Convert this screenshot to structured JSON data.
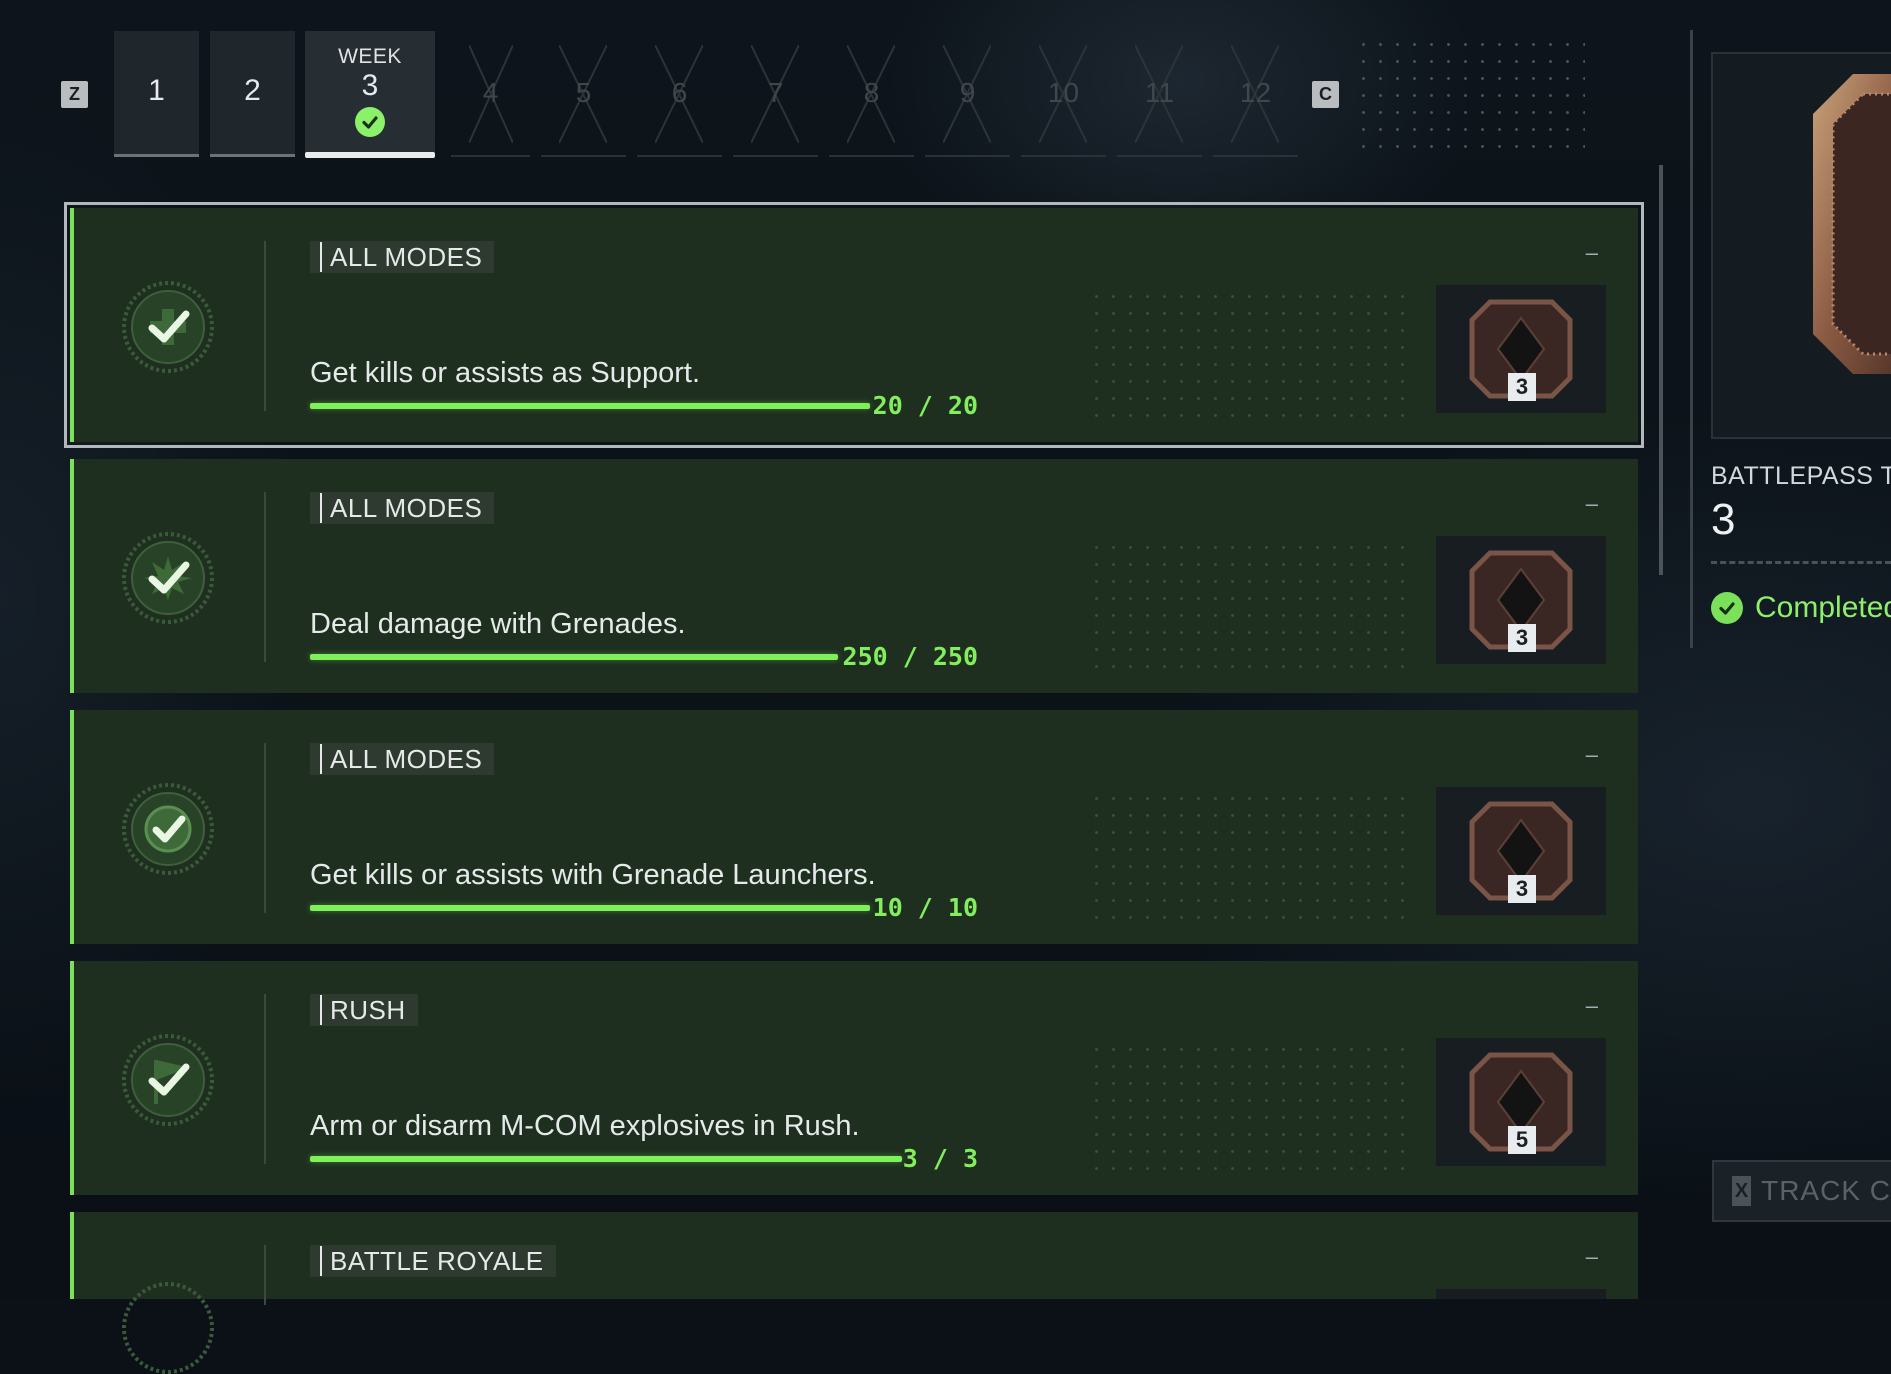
{
  "tabs": {
    "prev_key": "Z",
    "next_key": "C",
    "week_label": "WEEK",
    "weeks": [
      "1",
      "2",
      "3",
      "4",
      "5",
      "6",
      "7",
      "8",
      "9",
      "10",
      "11",
      "12"
    ],
    "active_week": "3",
    "active_week_status_icon": "check-circle-icon"
  },
  "challenges": [
    {
      "mode": "ALL MODES",
      "description": "Get kills or assists as Support.",
      "progress_text": "20 / 20",
      "progress": 1.0,
      "reward_qty": "3",
      "emblem_icon": "support-plus-icon",
      "collapse_symbol": "–"
    },
    {
      "mode": "ALL MODES",
      "description": "Deal damage with Grenades.",
      "progress_text": "250 / 250",
      "progress": 1.0,
      "reward_qty": "3",
      "emblem_icon": "grenade-burst-icon",
      "collapse_symbol": "–"
    },
    {
      "mode": "ALL MODES",
      "description": "Get kills or assists with Grenade Launchers.",
      "progress_text": "10 / 10",
      "progress": 1.0,
      "reward_qty": "3",
      "emblem_icon": "grenade-launcher-icon",
      "collapse_symbol": "–"
    },
    {
      "mode": "RUSH",
      "description": "Arm or disarm M-COM explosives in Rush.",
      "progress_text": "3 / 3",
      "progress": 1.0,
      "reward_qty": "5",
      "emblem_icon": "flag-icon",
      "collapse_symbol": "–"
    },
    {
      "mode": "BATTLE ROYALE",
      "description": "",
      "progress_text": "",
      "reward_qty": "",
      "emblem_icon": "laurel-icon",
      "collapse_symbol": "–"
    }
  ],
  "side_panel": {
    "title": "BATTLEPASS TO",
    "value": "3",
    "status": "Completed",
    "track_key": "X",
    "track_label": "TRACK C"
  },
  "colors": {
    "accent_green": "#7df05a",
    "card_bg": "#1e2f1f",
    "page_bg": "#0b1117"
  }
}
